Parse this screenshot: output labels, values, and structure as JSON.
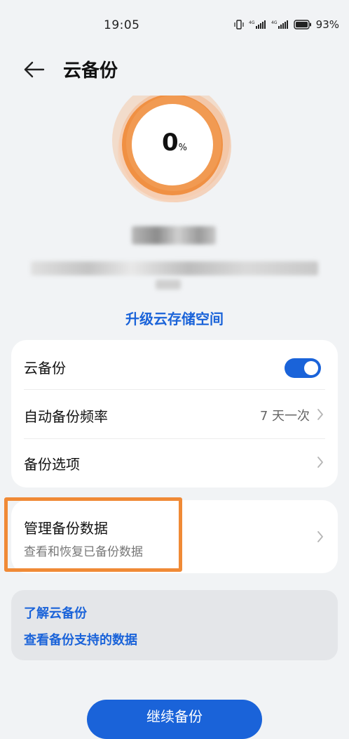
{
  "status_bar": {
    "time": "19:05",
    "battery": "93%",
    "icons": [
      "vibrate-icon",
      "signal-4g-icon",
      "signal-4g-icon",
      "battery-icon"
    ]
  },
  "header": {
    "title": "云备份",
    "back_icon": "back-arrow-icon"
  },
  "progress": {
    "percent": "0",
    "unit": "%",
    "value": 0,
    "ring_color": "#f08a36"
  },
  "upgrade_label": "升级云存储空间",
  "settings": {
    "cloud_backup": {
      "label": "云备份",
      "enabled": true
    },
    "auto_frequency": {
      "label": "自动备份频率",
      "value": "7 天一次"
    },
    "backup_options": {
      "label": "备份选项"
    }
  },
  "manage": {
    "title": "管理备份数据",
    "subtitle": "查看和恢复已备份数据"
  },
  "info": {
    "learn": "了解云备份",
    "supported": "查看备份支持的数据"
  },
  "cta_label": "继续备份",
  "colors": {
    "accent": "#1a63d9",
    "highlight": "#f08a36",
    "background": "#f1f3f5"
  }
}
